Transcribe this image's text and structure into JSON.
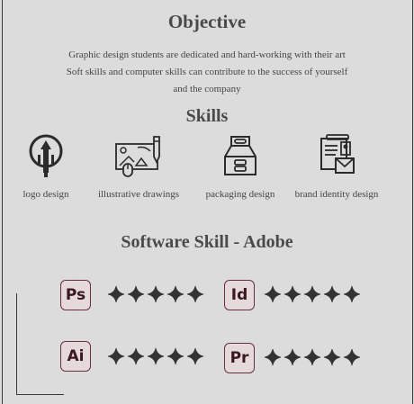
{
  "objective": {
    "title": "Objective",
    "lines": [
      "Graphic design students are dedicated and hard-working with their art",
      "Soft skills and computer skills can contribute to the success of yourself",
      "and the company"
    ]
  },
  "skills": {
    "title": "Skills",
    "items": [
      {
        "label": "logo design",
        "icon": "logo-design-icon"
      },
      {
        "label": "illustrative drawings",
        "icon": "illustration-icon"
      },
      {
        "label": "packaging design",
        "icon": "packaging-icon"
      },
      {
        "label": "brand identity design",
        "icon": "brand-identity-icon"
      }
    ]
  },
  "software": {
    "title": "Software Skill - Adobe",
    "apps": [
      {
        "abbr": "Ps",
        "rating": 5,
        "max": 5
      },
      {
        "abbr": "Id",
        "rating": 5,
        "max": 5
      },
      {
        "abbr": "Ai",
        "rating": 5,
        "max": 5
      },
      {
        "abbr": "Pr",
        "rating": 5,
        "max": 5
      }
    ]
  },
  "colors": {
    "background": "#dcdcdc",
    "text": "#3a3a3a",
    "badge_border": "#6a2f3c",
    "badge_fill": "#e6d9dc"
  }
}
